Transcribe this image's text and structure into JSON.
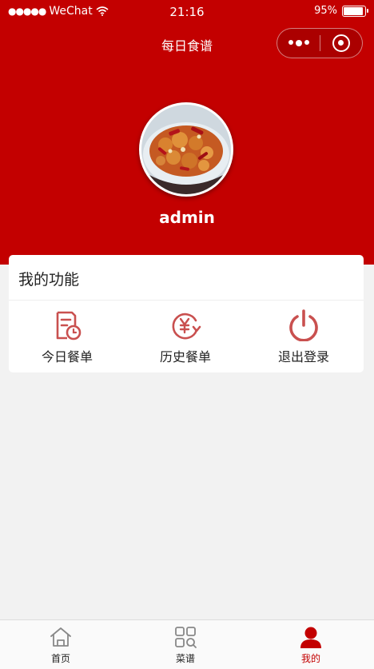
{
  "status_bar": {
    "signal_dots": "●●●●●",
    "carrier": "WeChat",
    "wifi_icon": "wifi-icon",
    "time": "21:16",
    "battery_percent": "95%",
    "battery_level": 0.95
  },
  "nav": {
    "title": "每日食谱"
  },
  "profile": {
    "username": "admin"
  },
  "functions": {
    "title": "我的功能",
    "items": [
      {
        "label": "今日餐单",
        "icon": "daily-menu-icon"
      },
      {
        "label": "历史餐单",
        "icon": "history-menu-icon"
      },
      {
        "label": "退出登录",
        "icon": "power-icon"
      }
    ]
  },
  "tabbar": {
    "items": [
      {
        "label": "首页",
        "icon": "home-icon",
        "active": false
      },
      {
        "label": "菜谱",
        "icon": "grid-search-icon",
        "active": false
      },
      {
        "label": "我的",
        "icon": "user-icon",
        "active": true
      }
    ]
  },
  "colors": {
    "primary": "#c30000",
    "icon_red": "#c9504f",
    "background": "#f2f2f2"
  }
}
